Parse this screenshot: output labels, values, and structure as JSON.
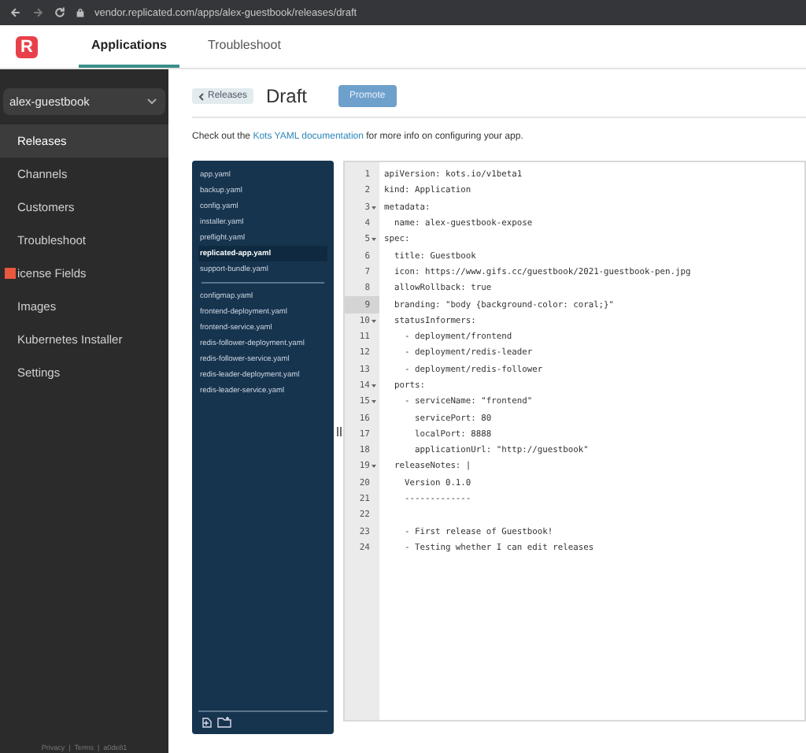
{
  "browser": {
    "url": "vendor.replicated.com/apps/alex-guestbook/releases/draft"
  },
  "nav": {
    "logo": "R",
    "tabs": [
      {
        "label": "Applications",
        "selected": true
      },
      {
        "label": "Troubleshoot",
        "selected": false
      }
    ]
  },
  "sidebar": {
    "app_selector": "alex-guestbook",
    "items": [
      {
        "label": "Releases",
        "selected": true
      },
      {
        "label": "Channels",
        "selected": false
      },
      {
        "label": "Customers",
        "selected": false
      },
      {
        "label": "Troubleshoot",
        "selected": false
      },
      {
        "label": "icense Fields",
        "selected": false,
        "overlay": true
      },
      {
        "label": "Images",
        "selected": false
      },
      {
        "label": "Kubernetes Installer",
        "selected": false
      },
      {
        "label": "Settings",
        "selected": false
      }
    ],
    "footer": "Privacy  |  Terms  |  a0de81"
  },
  "header": {
    "back": "Releases",
    "title": "Draft",
    "action": "Promote"
  },
  "intro": {
    "before": "Check out the ",
    "link": "Kots YAML documentation",
    "after": " for more info on configuring your app."
  },
  "file_groups": [
    [
      {
        "name": "app.yaml",
        "selected": false
      },
      {
        "name": "backup.yaml",
        "selected": false
      },
      {
        "name": "config.yaml",
        "selected": false
      },
      {
        "name": "installer.yaml",
        "selected": false
      },
      {
        "name": "preflight.yaml",
        "selected": false
      },
      {
        "name": "replicated-app.yaml",
        "selected": true
      },
      {
        "name": "support-bundle.yaml",
        "selected": false
      }
    ],
    [
      {
        "name": "configmap.yaml",
        "selected": false
      },
      {
        "name": "frontend-deployment.yaml",
        "selected": false
      },
      {
        "name": "frontend-service.yaml",
        "selected": false
      },
      {
        "name": "redis-follower-deployment.yaml",
        "selected": false
      },
      {
        "name": "redis-follower-service.yaml",
        "selected": false
      },
      {
        "name": "redis-leader-deployment.yaml",
        "selected": false
      },
      {
        "name": "redis-leader-service.yaml",
        "selected": false
      }
    ]
  ],
  "editor": {
    "lines": [
      {
        "number": "1",
        "fold": false,
        "active": false,
        "text": "apiVersion: kots.io/v1beta1"
      },
      {
        "number": "2",
        "fold": false,
        "active": false,
        "text": "kind: Application"
      },
      {
        "number": "3",
        "fold": true,
        "active": false,
        "text": "metadata:"
      },
      {
        "number": "4",
        "fold": false,
        "active": false,
        "text": "  name: alex-guestbook-expose"
      },
      {
        "number": "5",
        "fold": true,
        "active": false,
        "text": "spec:"
      },
      {
        "number": "6",
        "fold": false,
        "active": false,
        "text": "  title: Guestbook"
      },
      {
        "number": "7",
        "fold": false,
        "active": false,
        "text": "  icon: https://www.gifs.cc/guestbook/2021-guestbook-pen.jpg"
      },
      {
        "number": "8",
        "fold": false,
        "active": false,
        "text": "  allowRollback: true"
      },
      {
        "number": "9",
        "fold": false,
        "active": true,
        "text": "  branding: \"body {background-color: coral;}\""
      },
      {
        "number": "10",
        "fold": true,
        "active": false,
        "text": "  statusInformers:"
      },
      {
        "number": "11",
        "fold": false,
        "active": false,
        "text": "    - deployment/frontend"
      },
      {
        "number": "12",
        "fold": false,
        "active": false,
        "text": "    - deployment/redis-leader"
      },
      {
        "number": "13",
        "fold": false,
        "active": false,
        "text": "    - deployment/redis-follower"
      },
      {
        "number": "14",
        "fold": true,
        "active": false,
        "text": "  ports:"
      },
      {
        "number": "15",
        "fold": true,
        "active": false,
        "text": "    - serviceName: \"frontend\""
      },
      {
        "number": "16",
        "fold": false,
        "active": false,
        "text": "      servicePort: 80"
      },
      {
        "number": "17",
        "fold": false,
        "active": false,
        "text": "      localPort: 8888"
      },
      {
        "number": "18",
        "fold": false,
        "active": false,
        "text": "      applicationUrl: \"http://guestbook\""
      },
      {
        "number": "19",
        "fold": true,
        "active": false,
        "text": "  releaseNotes: |"
      },
      {
        "number": "20",
        "fold": false,
        "active": false,
        "text": "    Version 0.1.0"
      },
      {
        "number": "21",
        "fold": false,
        "active": false,
        "text": "    -------------"
      },
      {
        "number": "22",
        "fold": false,
        "active": false
      },
      {
        "number": "23",
        "fold": false,
        "active": false,
        "text": "    - First release of Guestbook!"
      },
      {
        "number": "24",
        "fold": false,
        "active": false,
        "text": "    - Testing whether I can edit releases"
      }
    ]
  }
}
